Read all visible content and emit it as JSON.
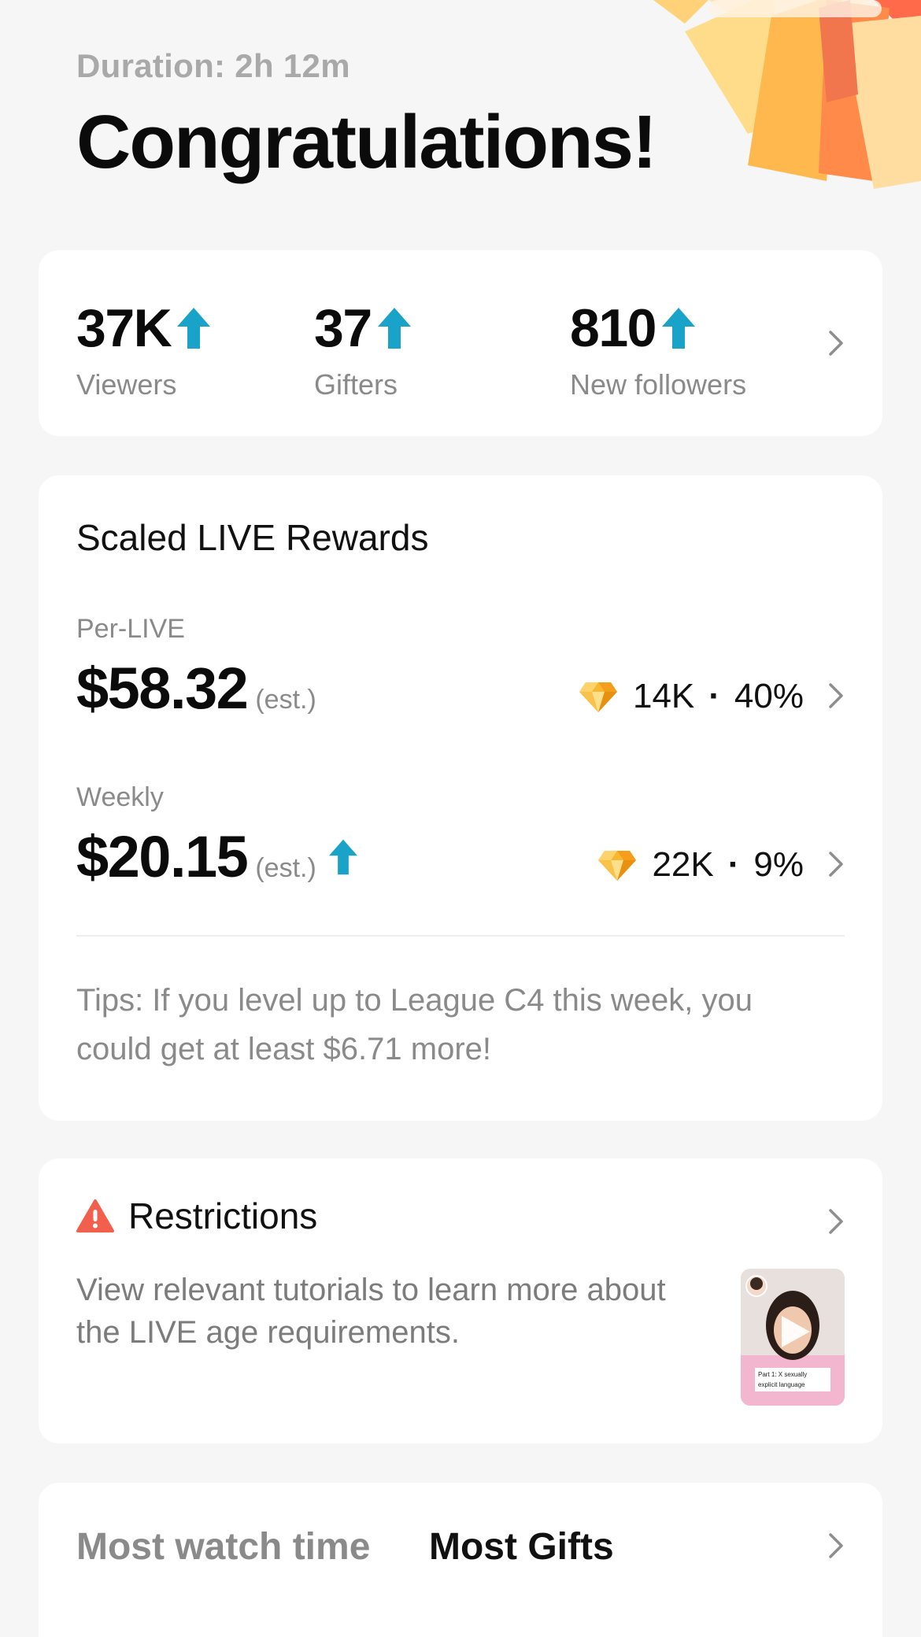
{
  "header": {
    "duration": "Duration: 2h 12m",
    "title": "Congratulations!"
  },
  "stats": [
    {
      "value": "37K",
      "label": "Viewers"
    },
    {
      "value": "37",
      "label": "Gifters"
    },
    {
      "value": "810",
      "label": "New followers"
    }
  ],
  "rewards": {
    "heading": "Scaled LIVE Rewards",
    "per_live": {
      "label": "Per-LIVE",
      "amount": "$58.32",
      "est": "(est.)",
      "diamonds": "14K",
      "percent": "40%"
    },
    "weekly": {
      "label": "Weekly",
      "amount": "$20.15",
      "est": "(est.)",
      "diamonds": "22K",
      "percent": "9%"
    },
    "tips": "Tips: If you level up to League C4 this week, you could get at least $6.71 more!"
  },
  "restrictions": {
    "title": "Restrictions",
    "description": "View relevant tutorials to learn more about the LIVE age requirements.",
    "thumbnail_caption": "Part 1: X sexually explicit language"
  },
  "bottom_tabs": [
    {
      "label": "Most watch time",
      "active": false
    },
    {
      "label": "Most Gifts",
      "active": true
    }
  ],
  "colors": {
    "accent_up": "#1aa3c8",
    "warning": "#f25f4c",
    "diamond": "#f7b733"
  },
  "icons": {
    "up": "up-arrow-icon",
    "chevron": "chevron-right-icon",
    "diamond": "diamond-icon",
    "warning": "warning-icon",
    "play": "play-icon"
  }
}
